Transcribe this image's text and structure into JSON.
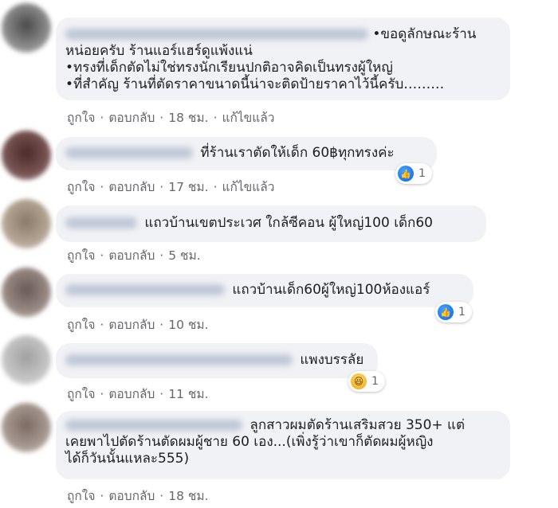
{
  "comments": [
    {
      "lines": [
        "•ขอดูลักษณะร้าน",
        "หน่อยครับ ร้านแอร์แฮร์ดูแพ้งแน่",
        "•ทรงที่เด็กตัดไม่ใช่ทรงนักเรียนปกติอาจคิดเป็นทรงผู้ใหญ่",
        "•ที่สำคัญ ร้านที่ตัดราคาขนาดนี้น่าจะติดป้ายราคาไว้นี้ครับ………"
      ],
      "actions": {
        "like": "ถูกใจ",
        "reply": "ตอบกลับ",
        "time": "18 ชม.",
        "edited": "แก้ไขแล้ว"
      }
    },
    {
      "lines": [
        "ที่ร้านเราตัดให้เด็ก 60฿ทุกทรงค่ะ"
      ],
      "actions": {
        "like": "ถูกใจ",
        "reply": "ตอบกลับ",
        "time": "17 ชม.",
        "edited": "แก้ไขแล้ว"
      },
      "reaction": {
        "icon": "like-icon",
        "count": "1"
      }
    },
    {
      "lines": [
        "แถวบ้านเขตประเวศ ใกล้ซีคอน ผู้ใหญ่100 เด็ก60"
      ],
      "actions": {
        "like": "ถูกใจ",
        "reply": "ตอบกลับ",
        "time": "5 ชม."
      }
    },
    {
      "lines": [
        "แถวบ้านเด็ก60ผู้ใหญ่100ห้องแอร์"
      ],
      "actions": {
        "like": "ถูกใจ",
        "reply": "ตอบกลับ",
        "time": "10 ชม."
      },
      "reaction": {
        "icon": "like-icon",
        "count": "1"
      }
    },
    {
      "lines": [
        "แพงบรรลัย"
      ],
      "actions": {
        "like": "ถูกใจ",
        "reply": "ตอบกลับ",
        "time": "11 ชม."
      },
      "reaction": {
        "icon": "haha-icon",
        "count": "1"
      }
    },
    {
      "lines": [
        "ลูกสาวผมตัดร้านเสริมสวย 350+ แต่",
        "เคยพาไปตัดร้านตัดผมผู้ชาย 60 เอง...(เพิ่งรู้ว่าเขาก็ตัดผมผู้หญิง",
        "ได้ก็วันนั้นแหละ555)"
      ],
      "actions": {
        "like": "ถูกใจ",
        "reply": "ตอบกลับ",
        "time": "18 ชม."
      }
    }
  ],
  "colors": {
    "bubble": "#f0f2f5",
    "meta": "#65676b",
    "like": "#1877f2"
  }
}
